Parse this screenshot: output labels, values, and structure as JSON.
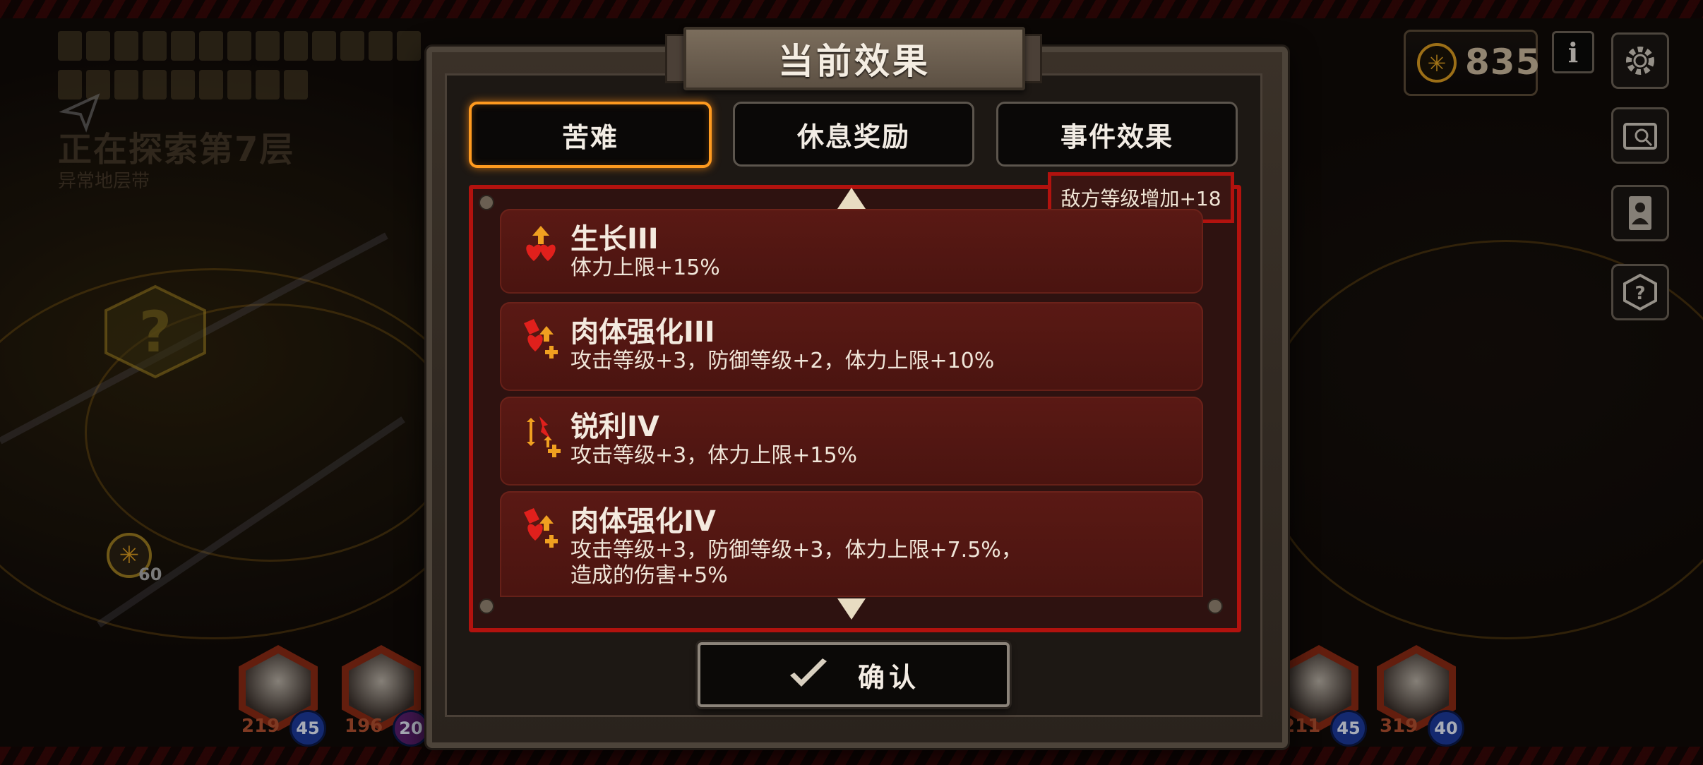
{
  "background": {
    "floor_title": "正在探索第7层",
    "floor_subtitle": "异常地层带",
    "stage_token_value": "60",
    "party_left": [
      {
        "hp": "219",
        "level": "45"
      },
      {
        "hp": "196",
        "level": "20"
      }
    ],
    "party_right": [
      {
        "hp": "211",
        "level": "45"
      },
      {
        "hp": "319",
        "level": "40"
      }
    ]
  },
  "hud": {
    "currency_value": "835",
    "info_label": "i",
    "icons": [
      "currency-icon",
      "info-icon",
      "settings-icon",
      "archive-icon",
      "character-icon",
      "help-icon"
    ]
  },
  "dialog": {
    "title": "当前效果",
    "tabs": [
      {
        "label": "苦难",
        "active": true
      },
      {
        "label": "休息奖励",
        "active": false
      },
      {
        "label": "事件效果",
        "active": false
      }
    ],
    "enemy_level_tag": "敌方等级增加+18",
    "effects": [
      {
        "name": "生长III",
        "desc": "体力上限+15%",
        "icon": "hp-up-icon"
      },
      {
        "name": "肉体强化III",
        "desc": "攻击等级+3，防御等级+2，体力上限+10%",
        "icon": "body-boost-icon"
      },
      {
        "name": "锐利IV",
        "desc": "攻击等级+3，体力上限+15%",
        "icon": "sharp-icon"
      },
      {
        "name": "肉体强化IV",
        "desc": "攻击等级+3，防御等级+3，体力上限+7.5%，\n造成的伤害+5%",
        "icon": "body-boost-icon"
      }
    ],
    "confirm_label": "确认"
  },
  "colors": {
    "accent_orange": "#ff9a1f",
    "panel_red": "#b2120e",
    "row_bg": "#5a1914"
  }
}
